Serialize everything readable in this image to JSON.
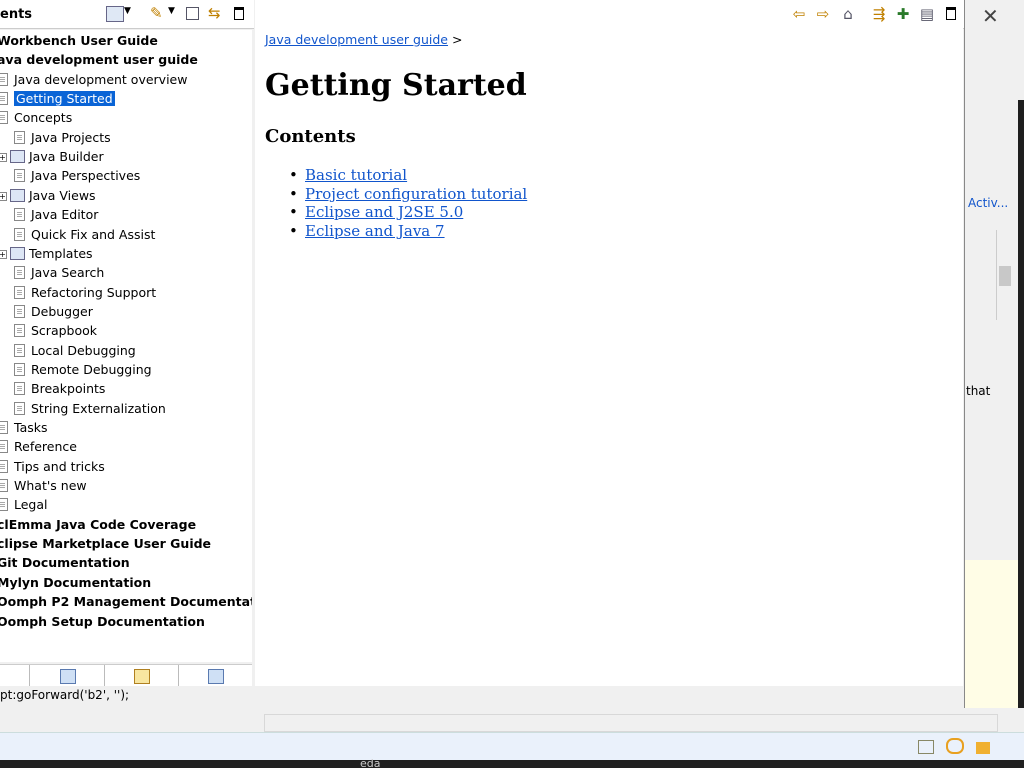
{
  "toc": {
    "title": "ents",
    "tree": [
      {
        "label": "Workbench User Guide",
        "level": 0,
        "bold": true,
        "icon": "none"
      },
      {
        "label": "ava development user guide",
        "level": 0,
        "bold": true,
        "icon": "none"
      },
      {
        "label": "Java development overview",
        "level": 1,
        "bold": false,
        "icon": "page-icon"
      },
      {
        "label": "Getting Started",
        "level": 1,
        "bold": false,
        "icon": "page-icon",
        "selected": true
      },
      {
        "label": "Concepts",
        "level": 1,
        "bold": false,
        "icon": "page-icon"
      },
      {
        "label": "Java Projects",
        "level": 2,
        "bold": false,
        "icon": "page-icon"
      },
      {
        "label": "Java Builder",
        "level": 2,
        "bold": false,
        "icon": "book-icon",
        "expandable": true
      },
      {
        "label": "Java Perspectives",
        "level": 2,
        "bold": false,
        "icon": "page-icon"
      },
      {
        "label": "Java Views",
        "level": 2,
        "bold": false,
        "icon": "book-icon",
        "expandable": true
      },
      {
        "label": "Java Editor",
        "level": 2,
        "bold": false,
        "icon": "page-icon"
      },
      {
        "label": "Quick Fix and Assist",
        "level": 2,
        "bold": false,
        "icon": "page-icon"
      },
      {
        "label": "Templates",
        "level": 2,
        "bold": false,
        "icon": "book-icon",
        "expandable": true
      },
      {
        "label": "Java Search",
        "level": 2,
        "bold": false,
        "icon": "page-icon"
      },
      {
        "label": "Refactoring Support",
        "level": 2,
        "bold": false,
        "icon": "page-icon"
      },
      {
        "label": "Debugger",
        "level": 2,
        "bold": false,
        "icon": "page-icon"
      },
      {
        "label": "Scrapbook",
        "level": 2,
        "bold": false,
        "icon": "page-icon"
      },
      {
        "label": "Local Debugging",
        "level": 2,
        "bold": false,
        "icon": "page-icon"
      },
      {
        "label": "Remote Debugging",
        "level": 2,
        "bold": false,
        "icon": "page-icon"
      },
      {
        "label": "Breakpoints",
        "level": 2,
        "bold": false,
        "icon": "page-icon"
      },
      {
        "label": "String Externalization",
        "level": 2,
        "bold": false,
        "icon": "page-icon"
      },
      {
        "label": "Tasks",
        "level": 1,
        "bold": false,
        "icon": "page-icon"
      },
      {
        "label": "Reference",
        "level": 1,
        "bold": false,
        "icon": "page-icon"
      },
      {
        "label": "Tips and tricks",
        "level": 1,
        "bold": false,
        "icon": "page-icon"
      },
      {
        "label": "What's new",
        "level": 1,
        "bold": false,
        "icon": "page-icon"
      },
      {
        "label": "Legal",
        "level": 1,
        "bold": false,
        "icon": "page-icon"
      },
      {
        "label": "clEmma Java Code Coverage",
        "level": 0,
        "bold": true,
        "icon": "none"
      },
      {
        "label": "clipse Marketplace User Guide",
        "level": 0,
        "bold": true,
        "icon": "none"
      },
      {
        "label": "Git Documentation",
        "level": 0,
        "bold": true,
        "icon": "none"
      },
      {
        "label": "Mylyn Documentation",
        "level": 0,
        "bold": true,
        "icon": "none"
      },
      {
        "label": "Oomph P2 Management Documentation",
        "level": 0,
        "bold": true,
        "icon": "none"
      },
      {
        "label": "Oomph Setup Documentation",
        "level": 0,
        "bold": true,
        "icon": "none"
      }
    ]
  },
  "content": {
    "breadcrumb_link": "Java development user guide",
    "breadcrumb_sep": ">",
    "title": "Getting Started",
    "contents_heading": "Contents",
    "links": [
      "Basic tutorial",
      "Project configuration tutorial",
      "Eclipse and J2SE 5.0",
      "Eclipse and Java 7"
    ]
  },
  "status": {
    "text": "pt:goForward('b2', '');"
  },
  "background": {
    "activity_text": "Activ...",
    "that_text": "that",
    "taskbar_text": "eda"
  },
  "colors": {
    "selection": "#0a64d6",
    "link": "#1155cc"
  }
}
